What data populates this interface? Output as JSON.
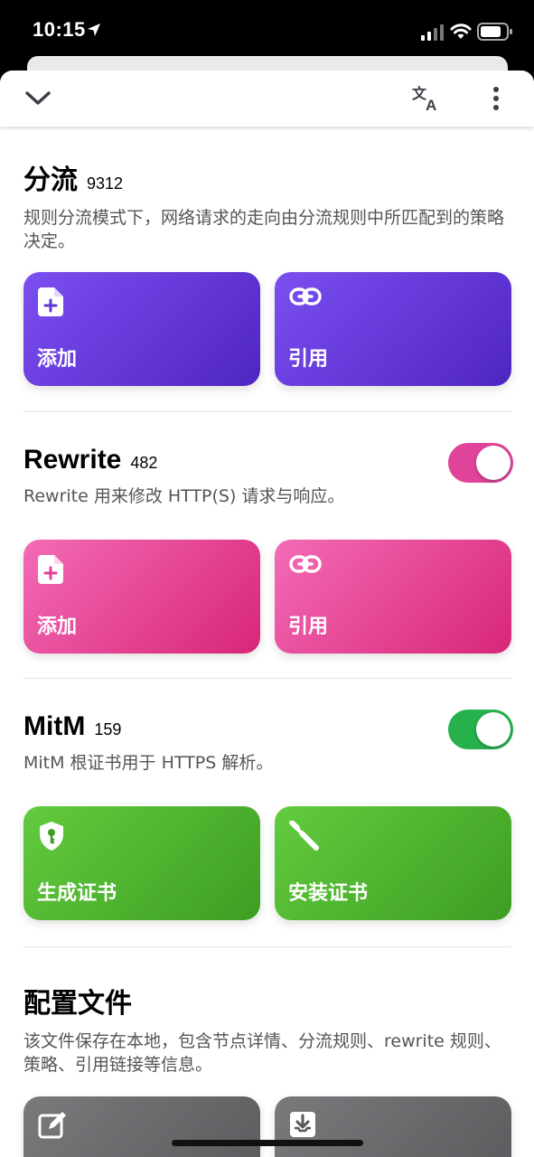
{
  "status_bar": {
    "time": "10:15"
  },
  "toolbar": {
    "collapse_icon": "chevron-down-icon",
    "translate_icon": "translate-icon",
    "more_icon": "more-vertical-icon"
  },
  "sections": {
    "routing": {
      "title": "分流",
      "count": "9312",
      "description": "规则分流模式下，网络请求的走向由分流规则中所匹配到的策略决定。",
      "buttons": [
        {
          "label": "添加",
          "icon": "file-plus-icon"
        },
        {
          "label": "引用",
          "icon": "link-icon"
        }
      ],
      "color": "#6a3ee0"
    },
    "rewrite": {
      "title": "Rewrite",
      "count": "482",
      "enabled": true,
      "description": "Rewrite 用来修改 HTTP(S) 请求与响应。",
      "buttons": [
        {
          "label": "添加",
          "icon": "file-plus-icon"
        },
        {
          "label": "引用",
          "icon": "link-icon"
        }
      ],
      "color": "#e23e95"
    },
    "mitm": {
      "title": "MitM",
      "count": "159",
      "enabled": true,
      "description": "MitM 根证书用于 HTTPS 解析。",
      "buttons": [
        {
          "label": "生成证书",
          "icon": "shield-key-icon"
        },
        {
          "label": "安装证书",
          "icon": "wrench-icon"
        }
      ],
      "color": "#27b14c"
    },
    "config": {
      "title": "配置文件",
      "description": "该文件保存在本地，包含节点详情、分流规则、rewrite 规则、策略、引用链接等信息。",
      "buttons": [
        {
          "label": "",
          "icon": "edit-icon"
        },
        {
          "label": "",
          "icon": "download-icon"
        }
      ],
      "color": "#6b6b6e"
    }
  }
}
